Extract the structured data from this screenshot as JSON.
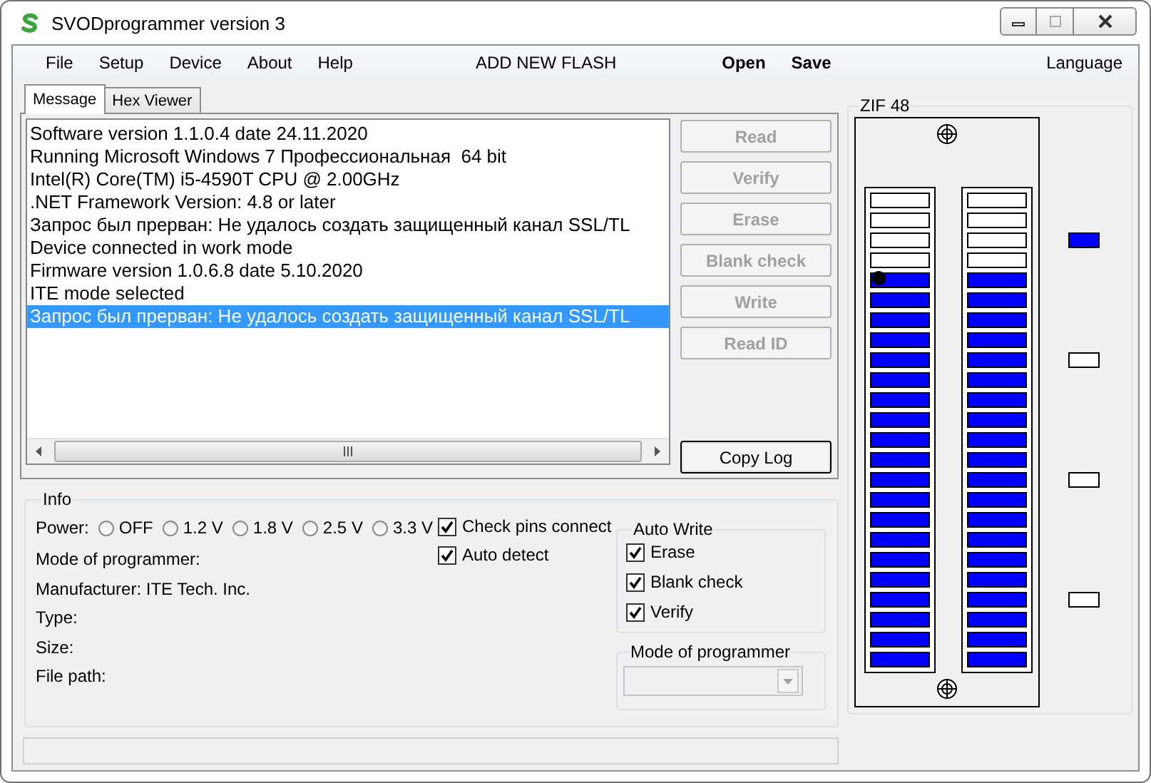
{
  "window": {
    "title": "SVODprogrammer version 3"
  },
  "menu": [
    {
      "label": "File",
      "kind": "item"
    },
    {
      "label": "Setup",
      "kind": "item"
    },
    {
      "label": "Device",
      "kind": "item"
    },
    {
      "label": "About",
      "kind": "item"
    },
    {
      "label": "Help",
      "kind": "item"
    },
    {
      "label": "ADD NEW FLASH",
      "kind": "center"
    },
    {
      "label": "Open",
      "kind": "bold"
    },
    {
      "label": "Save",
      "kind": "bold"
    },
    {
      "label": "Language",
      "kind": "right"
    }
  ],
  "tabs": [
    {
      "label": "Message",
      "selected": true
    },
    {
      "label": "Hex Viewer",
      "selected": false
    }
  ],
  "log": [
    {
      "text": "Software version 1.1.0.4 date 24.11.2020",
      "selected": false
    },
    {
      "text": "Running Microsoft Windows 7 Профессиональная  64 bit",
      "selected": false
    },
    {
      "text": "Intel(R) Core(TM) i5-4590T CPU @ 2.00GHz",
      "selected": false
    },
    {
      "text": ".NET Framework Version: 4.8 or later",
      "selected": false
    },
    {
      "text": "Запрос был прерван: Не удалось создать защищенный канал SSL/TL",
      "selected": false
    },
    {
      "text": "Device connected in work mode",
      "selected": false
    },
    {
      "text": "Firmware version 1.0.6.8 date 5.10.2020",
      "selected": false
    },
    {
      "text": "ITE mode selected",
      "selected": false
    },
    {
      "text": "Запрос был прерван: Не удалось создать защищенный канал SSL/TL",
      "selected": true
    }
  ],
  "actions": [
    {
      "label": "Read",
      "disabled": true
    },
    {
      "label": "Verify",
      "disabled": true
    },
    {
      "label": "Erase",
      "disabled": true
    },
    {
      "label": "Blank check",
      "disabled": true
    },
    {
      "label": "Write",
      "disabled": true
    },
    {
      "label": "Read ID",
      "disabled": true
    }
  ],
  "copy_button": {
    "label": "Copy Log",
    "disabled": false
  },
  "info": {
    "title": "Info",
    "power_label": "Power:",
    "power": [
      {
        "label": "OFF",
        "selected": false
      },
      {
        "label": "1.2 V",
        "selected": false
      },
      {
        "label": "1.8 V",
        "selected": false
      },
      {
        "label": "2.5 V",
        "selected": false
      },
      {
        "label": "3.3 V",
        "selected": false
      }
    ],
    "checks": [
      {
        "label": "Check pins connect",
        "checked": true
      },
      {
        "label": "Auto detect",
        "checked": true
      }
    ],
    "fields": [
      "Mode of programmer:",
      "Manufacturer: ITE Tech. Inc.",
      "Type:",
      "Size:",
      "File path:"
    ],
    "auto_write": {
      "title": "Auto Write",
      "options": [
        {
          "label": "Erase",
          "checked": true
        },
        {
          "label": "Blank check",
          "checked": true
        },
        {
          "label": "Verify",
          "checked": true
        }
      ]
    },
    "mode": {
      "title": "Mode of programmer",
      "disabled": true
    }
  },
  "zif": {
    "title": "ZIF 48",
    "rows": [
      {
        "active": false
      },
      {
        "active": false
      },
      {
        "active": false
      },
      {
        "active": false
      },
      {
        "active": true
      },
      {
        "active": true
      },
      {
        "active": true
      },
      {
        "active": true
      },
      {
        "active": true
      },
      {
        "active": true
      },
      {
        "active": true
      },
      {
        "active": true
      },
      {
        "active": true
      },
      {
        "active": true
      },
      {
        "active": true
      },
      {
        "active": true
      },
      {
        "active": true
      },
      {
        "active": true
      },
      {
        "active": true
      },
      {
        "active": true
      },
      {
        "active": true
      },
      {
        "active": true
      },
      {
        "active": true
      },
      {
        "active": true
      }
    ],
    "indicators": [
      {
        "active": true
      },
      {
        "active": false
      },
      {
        "active": false
      },
      {
        "active": false
      }
    ]
  }
}
